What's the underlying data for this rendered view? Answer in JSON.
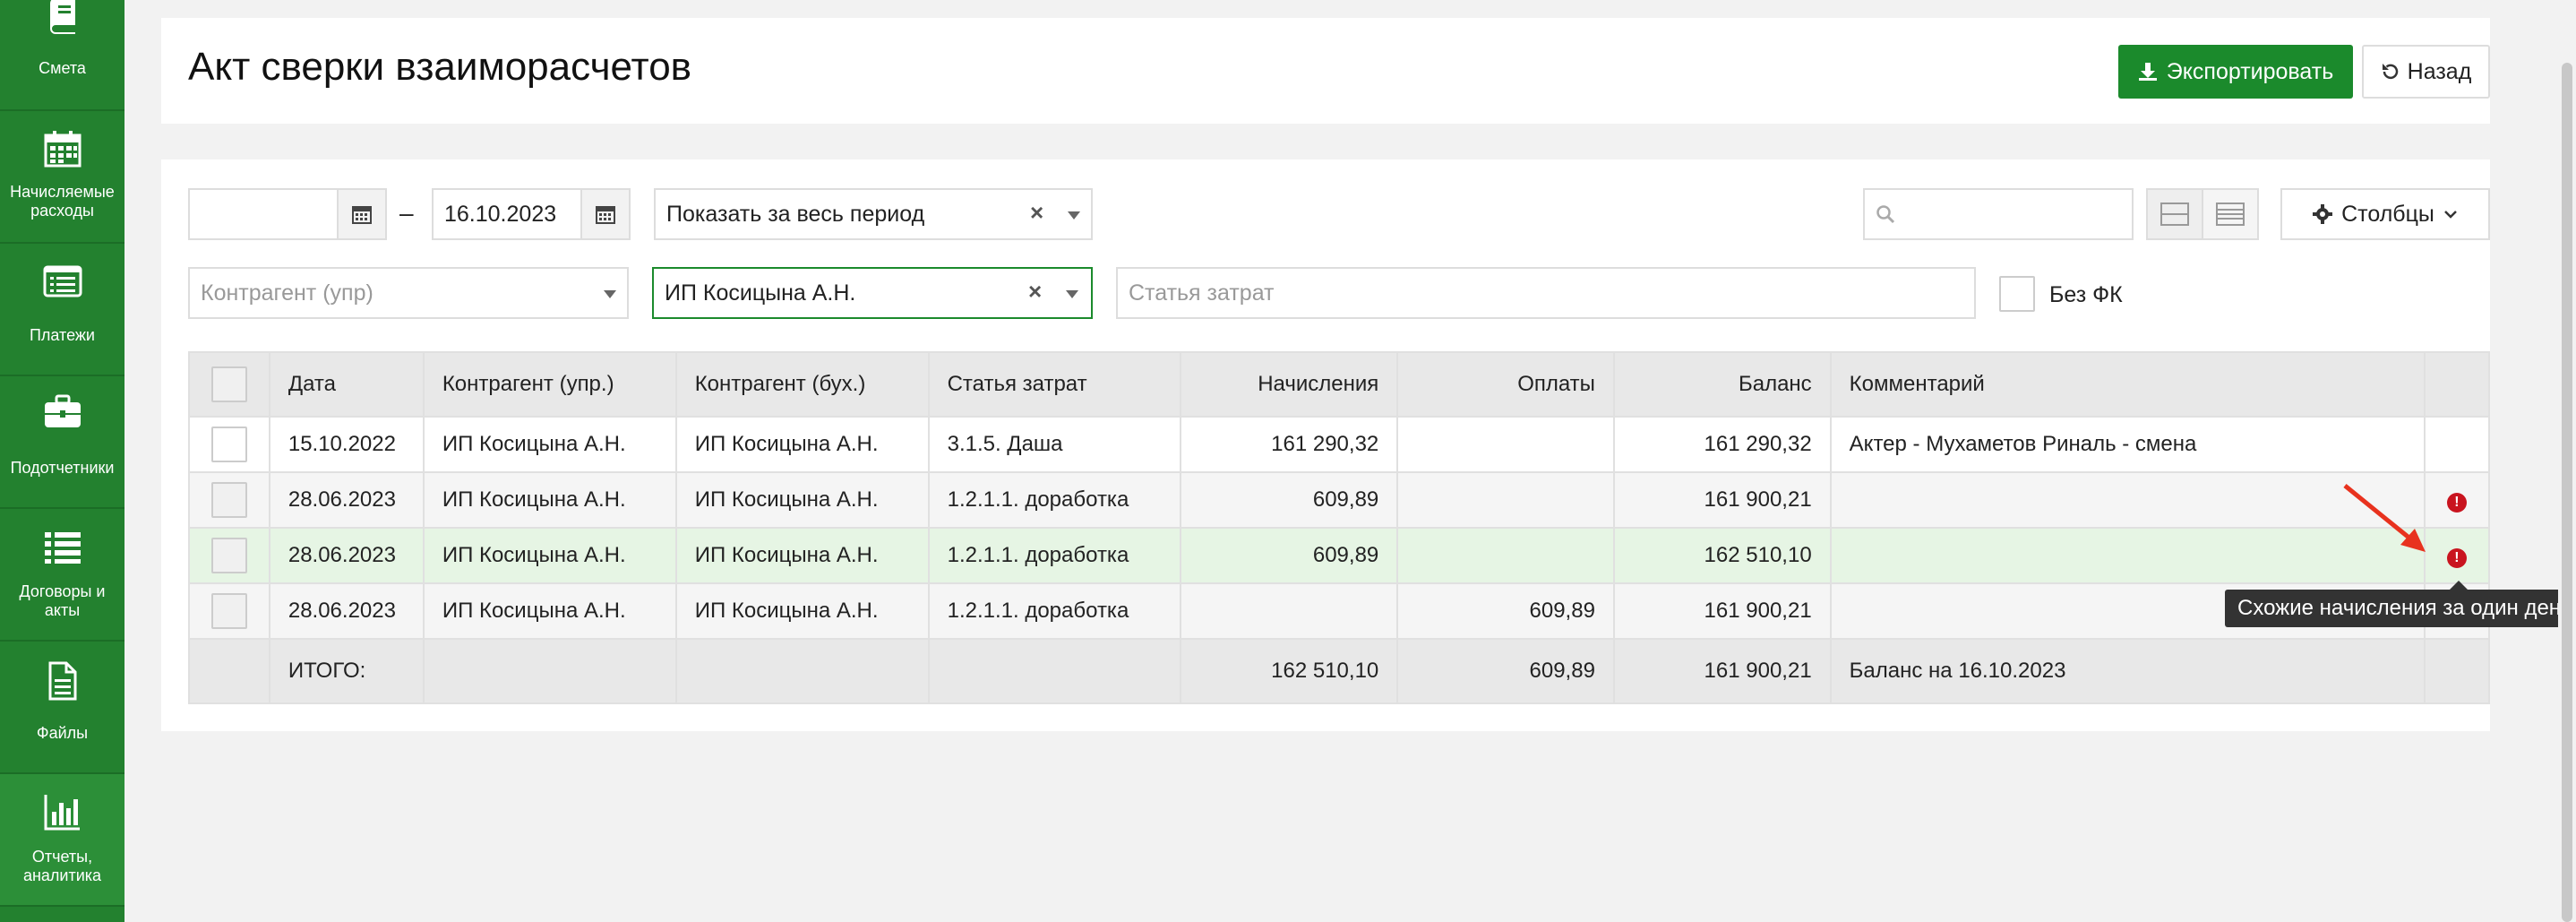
{
  "sidebar": {
    "items": [
      {
        "label": "Смета",
        "icon": "book-icon"
      },
      {
        "label": "Начисляемые расходы",
        "icon": "calendar-icon"
      },
      {
        "label": "Платежи",
        "icon": "list-window-icon"
      },
      {
        "label": "Подотчетники",
        "icon": "briefcase-icon"
      },
      {
        "label": "Договоры и акты",
        "icon": "list-icon"
      },
      {
        "label": "Файлы",
        "icon": "file-icon"
      },
      {
        "label": "Отчеты, аналитика",
        "icon": "bar-chart-icon"
      }
    ]
  },
  "header": {
    "title": "Акт сверки взаиморасчетов",
    "export_label": "Экспортировать",
    "back_label": "Назад"
  },
  "filters": {
    "date_from": "",
    "date_separator": "–",
    "date_to": "16.10.2023",
    "period": "Показать за весь период",
    "search": "",
    "columns_label": "Столбцы",
    "counterparty_mgmt_placeholder": "Контрагент (упр)",
    "counterparty_acc": "ИП Косицына А.Н.",
    "expense_placeholder": "Статья затрат",
    "no_fk_label": "Без ФК"
  },
  "table": {
    "headers": [
      "Дата",
      "Контрагент (упр.)",
      "Контрагент (бух.)",
      "Статья затрат",
      "Начисления",
      "Оплаты",
      "Баланс",
      "Комментарий"
    ],
    "rows": [
      {
        "date": "15.10.2022",
        "cp_mgmt": "ИП Косицына А.Н.",
        "cp_acc": "ИП Косицына А.Н.",
        "expense": "3.1.5. Даша",
        "accrual": "161 290,32",
        "payment": "",
        "balance": "161 290,32",
        "comment": "Актер - Мухаметов Риналь - смена",
        "warn": false
      },
      {
        "date": "28.06.2023",
        "cp_mgmt": "ИП Косицына А.Н.",
        "cp_acc": "ИП Косицына А.Н.",
        "expense": "1.2.1.1. доработка",
        "accrual": "609,89",
        "payment": "",
        "balance": "161 900,21",
        "comment": "",
        "warn": true
      },
      {
        "date": "28.06.2023",
        "cp_mgmt": "ИП Косицына А.Н.",
        "cp_acc": "ИП Косицына А.Н.",
        "expense": "1.2.1.1. доработка",
        "accrual": "609,89",
        "payment": "",
        "balance": "162 510,10",
        "comment": "",
        "warn": true
      },
      {
        "date": "28.06.2023",
        "cp_mgmt": "ИП Косицына А.Н.",
        "cp_acc": "ИП Косицына А.Н.",
        "expense": "1.2.1.1. доработка",
        "accrual": "",
        "payment": "609,89",
        "balance": "161 900,21",
        "comment": "",
        "warn": false
      }
    ],
    "footer": {
      "label": "ИТОГО:",
      "accrual": "162 510,10",
      "payment": "609,89",
      "balance": "161 900,21",
      "comment": "Баланс на 16.10.2023"
    }
  },
  "tooltip": "Схожие начисления за один день",
  "colors": {
    "sidebar": "#23812f",
    "primary_button": "#1b8a2c",
    "highlight_row": "#e6f5e4",
    "warning": "#c9141f",
    "annotation_arrow": "#e8321e"
  }
}
